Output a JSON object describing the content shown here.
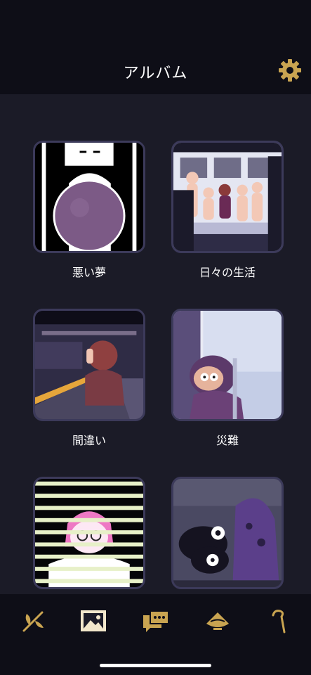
{
  "header": {
    "title": "アルバム",
    "settings_icon": "gear-icon"
  },
  "album": {
    "items": [
      {
        "label": "悪い夢"
      },
      {
        "label": "日々の生活"
      },
      {
        "label": "間違い"
      },
      {
        "label": "災難"
      },
      {
        "label": ""
      },
      {
        "label": ""
      }
    ]
  },
  "tabbar": {
    "tabs": [
      {
        "icon": "sprout-icon"
      },
      {
        "icon": "album-icon",
        "selected": true
      },
      {
        "icon": "chat-icon"
      },
      {
        "icon": "bowl-icon"
      },
      {
        "icon": "cane-icon"
      }
    ]
  },
  "colors": {
    "background": "#1b1b27",
    "header": "#0e0e17",
    "accent_gold": "#c9a451",
    "tile_border": "#3c3a5a"
  }
}
